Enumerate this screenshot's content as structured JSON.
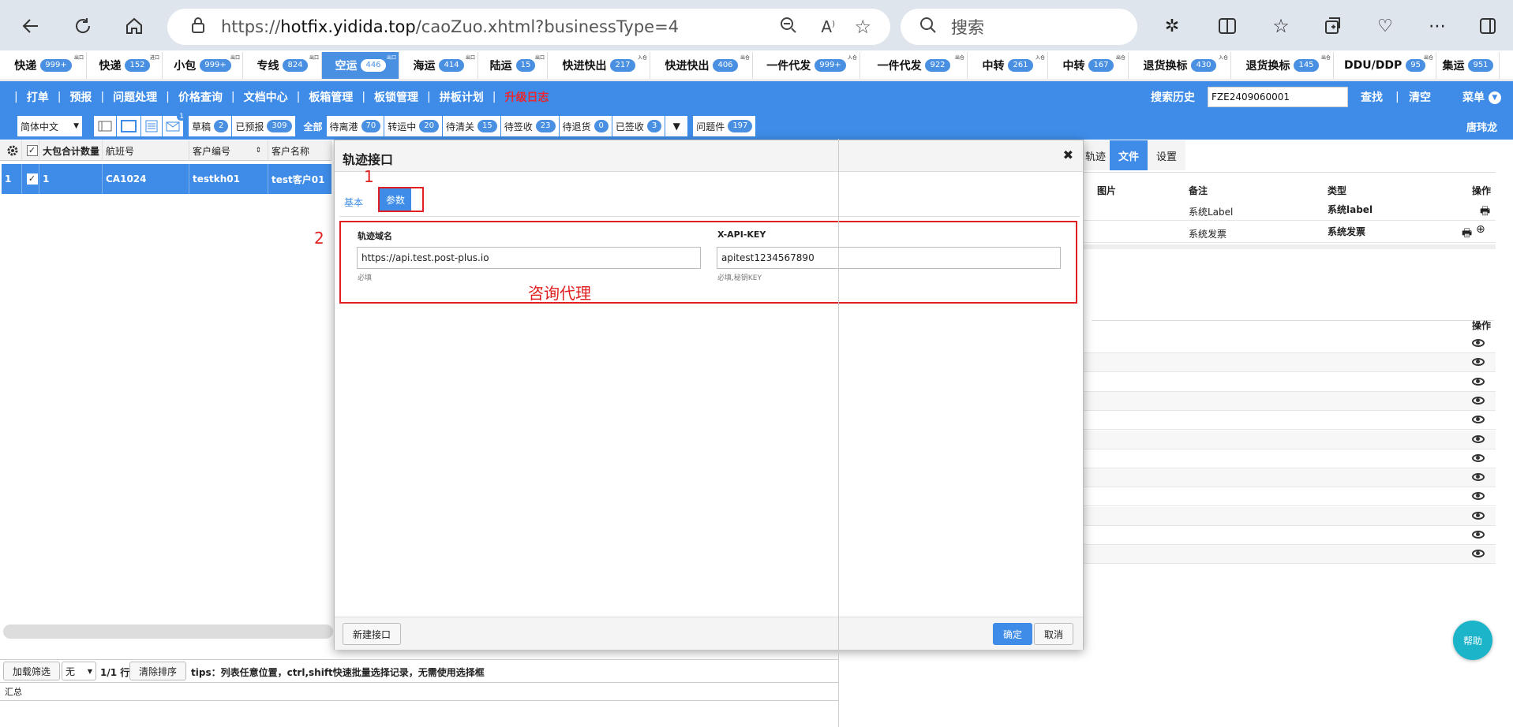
{
  "browser": {
    "url_prefix": "https://",
    "url_domain": "hotfix.yidida.top",
    "url_path": "/caoZuo.xhtml?businessType=4",
    "search_placeholder": "搜索"
  },
  "tabs": [
    {
      "label": "快递",
      "count": "999+",
      "corner": "出口",
      "active": false,
      "w": 110
    },
    {
      "label": "快递",
      "count": "152",
      "corner": "进口",
      "active": false,
      "w": 96
    },
    {
      "label": "小包",
      "count": "999+",
      "corner": "出口",
      "active": false,
      "w": 102
    },
    {
      "label": "专线",
      "count": "824",
      "corner": "出口",
      "active": false,
      "w": 100
    },
    {
      "label": "空运",
      "count": "446",
      "corner": "出口",
      "active": true,
      "w": 98
    },
    {
      "label": "海运",
      "count": "414",
      "corner": "出口",
      "active": false,
      "w": 100
    },
    {
      "label": "陆运",
      "count": "15",
      "corner": "出口",
      "active": false,
      "w": 88
    },
    {
      "label": "快进快出",
      "count": "217",
      "corner": "入仓",
      "active": false,
      "w": 130
    },
    {
      "label": "快进快出",
      "count": "406",
      "corner": "出仓",
      "active": false,
      "w": 130
    },
    {
      "label": "一件代发",
      "count": "999+",
      "corner": "入仓",
      "active": false,
      "w": 136
    },
    {
      "label": "一件代发",
      "count": "922",
      "corner": "出仓",
      "active": false,
      "w": 136
    },
    {
      "label": "中转",
      "count": "261",
      "corner": "入仓",
      "active": false,
      "w": 102
    },
    {
      "label": "中转",
      "count": "167",
      "corner": "出仓",
      "active": false,
      "w": 102
    },
    {
      "label": "退货换标",
      "count": "430",
      "corner": "入仓",
      "active": false,
      "w": 130
    },
    {
      "label": "退货换标",
      "count": "145",
      "corner": "出仓",
      "active": false,
      "w": 130
    },
    {
      "label": "DDU/DDP",
      "count": "95",
      "corner": "出仓",
      "active": false,
      "w": 130
    },
    {
      "label": "集运",
      "count": "951",
      "corner": "",
      "active": false,
      "w": 80
    }
  ],
  "toolbar": {
    "items": [
      "打单",
      "预报",
      "问题处理",
      "价格查询",
      "文档中心",
      "板箱管理",
      "板锁管理",
      "拼板计划"
    ],
    "log": "升级日志",
    "search_history": "搜索历史",
    "search_value": "FZE2409060001",
    "find": "查找",
    "clear": "清空",
    "menu": "菜单"
  },
  "filter": {
    "language": "简体中文",
    "mail_count": "1",
    "draft": "草稿",
    "draft_count": "2",
    "forecasted": "已预报",
    "forecasted_count": "309",
    "all": "全部",
    "statuses": [
      {
        "l": "待离港",
        "c": "70"
      },
      {
        "l": "转运中",
        "c": "20"
      },
      {
        "l": "待清关",
        "c": "15"
      },
      {
        "l": "待签收",
        "c": "23"
      },
      {
        "l": "待退货",
        "c": "0"
      },
      {
        "l": "已签收",
        "c": "3"
      }
    ],
    "problem": "问题件",
    "problem_count": "197",
    "user": "唐玮龙"
  },
  "grid": {
    "headers": [
      "大包合计数量",
      "航班号",
      "客户编号",
      "客户名称"
    ],
    "row": {
      "index": "1",
      "qty": "1",
      "flight": "CA1024",
      "code": "testkh01",
      "name": "test客户01"
    }
  },
  "right": {
    "tabs": [
      "轨迹",
      "文件",
      "设置"
    ],
    "headers": [
      "图片",
      "备注",
      "类型",
      "操作"
    ],
    "rows": [
      {
        "note": "系统Label",
        "type": "系统label"
      },
      {
        "note": "系统发票",
        "type": "系统发票"
      }
    ],
    "op2": "操作"
  },
  "modal": {
    "title": "轨迹接口",
    "tab_basic": "基本",
    "tab_params": "参数",
    "field1_label": "轨迹域名",
    "field1_value": "https://api.test.post-plus.io",
    "field1_hint": "必填",
    "field2_label": "X-API-KEY",
    "field2_value": "apitest1234567890",
    "field2_hint": "必填,秘钥KEY",
    "annotation": "咨询代理",
    "marker1": "1",
    "marker2": "2",
    "new_btn": "新建接口",
    "ok": "确定",
    "cancel": "取消"
  },
  "bottom": {
    "load_filter": "加载筛选",
    "none": "无",
    "rows_info": "1/1 行",
    "clear_sort": "清除排序",
    "tips": "tips：列表任意位置，ctrl,shift快速批量选择记录，无需使用选择框",
    "summary": "汇总"
  },
  "help": "帮助",
  "colors": {
    "primary": "#3e8ce8",
    "accent_red": "#e02020",
    "help": "#1bb4c9"
  }
}
